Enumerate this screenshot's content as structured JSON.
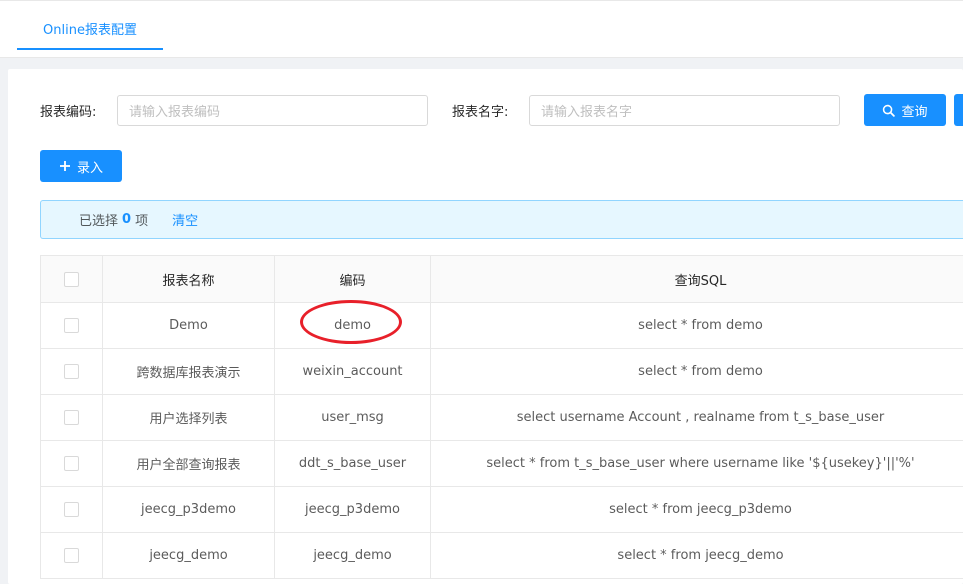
{
  "tabs": [
    {
      "label": "Online报表配置",
      "active": true
    }
  ],
  "search": {
    "code_label": "报表编码:",
    "code_placeholder": "请输入报表编码",
    "name_label": "报表名字:",
    "name_placeholder": "请输入报表名字",
    "query_label": "查询"
  },
  "toolbar": {
    "add_label": "录入"
  },
  "selection": {
    "prefix": "已选择",
    "count": "0",
    "suffix": "项",
    "clear_label": "清空"
  },
  "table": {
    "columns": [
      "报表名称",
      "编码",
      "查询SQL"
    ],
    "rows": [
      {
        "name": "Demo",
        "code": "demo",
        "sql": "select * from demo"
      },
      {
        "name": "跨数据库报表演示",
        "code": "weixin_account",
        "sql": "select * from demo"
      },
      {
        "name": "用户选择列表",
        "code": "user_msg",
        "sql": "select username Account , realname from t_s_base_user"
      },
      {
        "name": "用户全部查询报表",
        "code": "ddt_s_base_user",
        "sql": "select * from t_s_base_user where username like '${usekey}'||'%'"
      },
      {
        "name": "jeecg_p3demo",
        "code": "jeecg_p3demo",
        "sql": "select * from jeecg_p3demo"
      },
      {
        "name": "jeecg_demo",
        "code": "jeecg_demo",
        "sql": "select * from jeecg_demo"
      }
    ]
  },
  "colors": {
    "primary": "#1890ff",
    "annotation": "#e8202a"
  },
  "icons": {
    "query": "search-icon",
    "add": "plus-icon"
  }
}
